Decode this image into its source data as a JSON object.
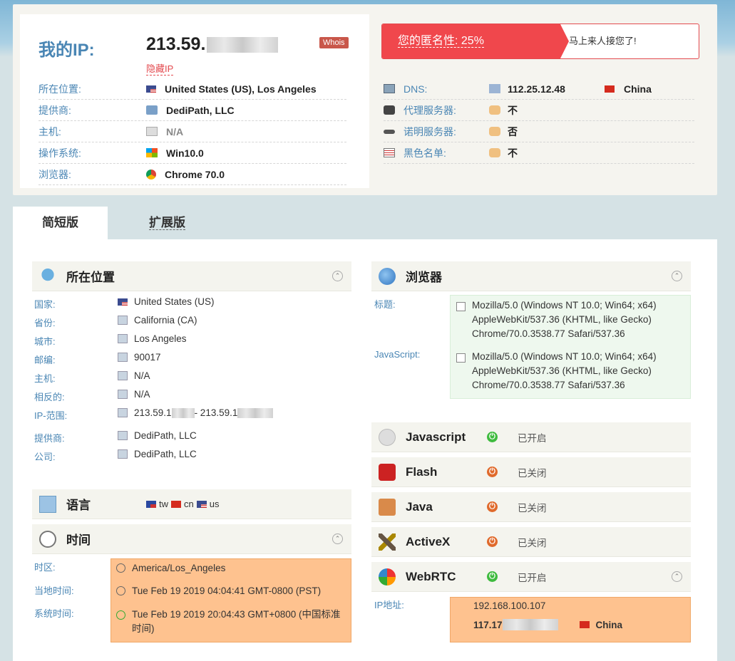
{
  "header": {
    "my_ip_label": "我的IP:",
    "ip_visible": "213.59.",
    "hide_ip": "隐藏IP",
    "whois": "Whois",
    "rows": [
      {
        "label": "所在位置:",
        "value": "United States (US), Los Angeles",
        "icon": "us-flag-icon"
      },
      {
        "label": "提供商:",
        "value": "DediPath, LLC",
        "icon": "isp-icon"
      },
      {
        "label": "主机:",
        "value": "N/A",
        "icon": "host-icon"
      },
      {
        "label": "操作系统:",
        "value": "Win10.0",
        "icon": "windows-icon"
      },
      {
        "label": "浏览器:",
        "value": "Chrome 70.0",
        "icon": "chrome-icon"
      }
    ],
    "anonymity": {
      "label": "您的匿名性: 25%",
      "message": "马上来人接您了!"
    },
    "right_rows": [
      {
        "label": "DNS:",
        "value": "112.25.12.48",
        "extra": "China"
      },
      {
        "label": "代理服务器:",
        "value": "不"
      },
      {
        "label": "诺明服务器:",
        "value": "否"
      },
      {
        "label": "黑色名单:",
        "value": "不"
      }
    ]
  },
  "tabs": [
    "简短版",
    "扩展版"
  ],
  "location": {
    "title": "所在位置",
    "rows": [
      {
        "label": "国家:",
        "value": "United States (US)"
      },
      {
        "label": "省份:",
        "value": "California (CA)"
      },
      {
        "label": "城市:",
        "value": "Los Angeles"
      },
      {
        "label": "邮编:",
        "value": "90017"
      },
      {
        "label": "主机:",
        "value": "N/A"
      },
      {
        "label": "相反的:",
        "value": "N/A"
      },
      {
        "label": "IP-范围:",
        "value_a": "213.59.1",
        "value_b": " - 213.59.1"
      },
      {
        "label": "提供商:",
        "value": "DediPath, LLC"
      },
      {
        "label": "公司:",
        "value": "DediPath, LLC"
      }
    ]
  },
  "language": {
    "title": "语言",
    "items": [
      "tw",
      "cn",
      "us"
    ]
  },
  "time": {
    "title": "时间",
    "rows": [
      {
        "label": "时区:",
        "value": "America/Los_Angeles"
      },
      {
        "label": "当地时间:",
        "value": "Tue Feb 19 2019 04:04:41 GMT-0800 (PST)"
      },
      {
        "label": "系统时间:",
        "value": "Tue Feb 19 2019 20:04:43 GMT+0800 (中国标准时间)"
      }
    ]
  },
  "browser": {
    "title": "浏览器",
    "rows": [
      {
        "label": "标题:",
        "value": "Mozilla/5.0 (Windows NT 10.0; Win64; x64) AppleWebKit/537.36 (KHTML, like Gecko) Chrome/70.0.3538.77 Safari/537.36"
      },
      {
        "label": "JavaScript:",
        "value": "Mozilla/5.0 (Windows NT 10.0; Win64; x64) AppleWebKit/537.36 (KHTML, like Gecko) Chrome/70.0.3538.77 Safari/537.36"
      }
    ]
  },
  "plugins": [
    {
      "name": "Javascript",
      "status": "已开启",
      "on": true
    },
    {
      "name": "Flash",
      "status": "已关闭",
      "on": false
    },
    {
      "name": "Java",
      "status": "已关闭",
      "on": false
    },
    {
      "name": "ActiveX",
      "status": "已关闭",
      "on": false
    },
    {
      "name": "WebRTC",
      "status": "已开启",
      "on": true
    }
  ],
  "webrtc": {
    "label": "IP地址:",
    "local_ip": "192.168.100.107",
    "public_ip": "117.17",
    "country": "China"
  },
  "colors": {
    "accent_red": "#f0474c",
    "label_blue": "#4a86b4",
    "orange_box": "#fec28f",
    "green_box": "#eef8ee"
  }
}
